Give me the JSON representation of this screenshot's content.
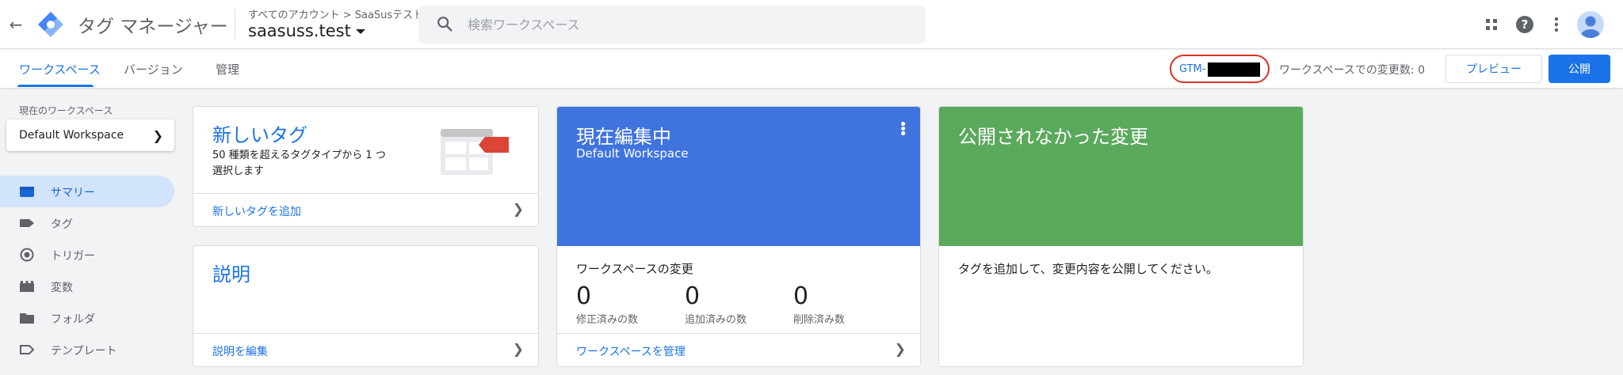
{
  "header": {
    "app_title": "タグ マネージャー",
    "breadcrumb": "すべてのアカウント > SaaSusテスト",
    "container_name": "saasuss.test",
    "search_placeholder": "検索ワークスペース"
  },
  "tabs": [
    {
      "label": "ワークスペース",
      "active": true
    },
    {
      "label": "バージョン",
      "active": false
    },
    {
      "label": "管理",
      "active": false
    }
  ],
  "toolbar": {
    "gtm_id_prefix": "GTM-",
    "changes_label": "ワークスペースでの変更数: 0",
    "preview_label": "プレビュー",
    "publish_label": "公開"
  },
  "sidebar": {
    "current_workspace_label": "現在のワークスペース",
    "workspace_name": "Default Workspace",
    "items": [
      {
        "label": "サマリー",
        "icon": "summary-icon",
        "active": true
      },
      {
        "label": "タグ",
        "icon": "tag-icon",
        "active": false
      },
      {
        "label": "トリガー",
        "icon": "trigger-icon",
        "active": false
      },
      {
        "label": "変数",
        "icon": "variable-icon",
        "active": false
      },
      {
        "label": "フォルダ",
        "icon": "folder-icon",
        "active": false
      },
      {
        "label": "テンプレート",
        "icon": "template-icon",
        "active": false
      }
    ]
  },
  "cards": {
    "new_tag": {
      "title": "新しいタグ",
      "desc": "50 種類を超えるタグタイプから 1 つ選択します",
      "link": "新しいタグを追加"
    },
    "description": {
      "title": "説明",
      "link": "説明を編集"
    },
    "editing": {
      "title": "現在編集中",
      "subtitle": "Default Workspace",
      "changes_heading": "ワークスペースの変更",
      "stats": [
        {
          "value": "0",
          "label": "修正済みの数"
        },
        {
          "value": "0",
          "label": "追加済みの数"
        },
        {
          "value": "0",
          "label": "削除済み数"
        }
      ],
      "link": "ワークスペースを管理"
    },
    "unpublished": {
      "title": "公開されなかった変更",
      "message": "タグを追加して、変更内容を公開してください。"
    }
  },
  "colors": {
    "accent": "#1a73e8",
    "editing_bg": "#3f73de",
    "unpublished_bg": "#5aa95c",
    "highlight_ring": "#d93025"
  }
}
